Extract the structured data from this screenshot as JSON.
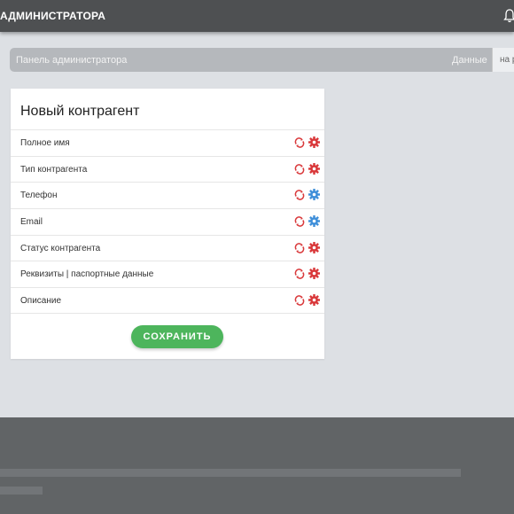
{
  "header": {
    "title": "АДМИНИСТРАТОРА",
    "notification_icon": "bell-icon"
  },
  "breadcrumb": {
    "home": "Панель администратора",
    "current": "Данные",
    "cut_off": "на р"
  },
  "form": {
    "title": "Новый контрагент",
    "fields": [
      {
        "label": "Полное имя",
        "gear_color": "#d9383a"
      },
      {
        "label": "Тип контрагента",
        "gear_color": "#d9383a"
      },
      {
        "label": "Телефон",
        "gear_color": "#3f8fd9"
      },
      {
        "label": "Email",
        "gear_color": "#3f8fd9"
      },
      {
        "label": "Статус контрагента",
        "gear_color": "#d9383a"
      },
      {
        "label": "Реквизиты | паспортные данные",
        "gear_color": "#d9383a"
      },
      {
        "label": "Описание",
        "gear_color": "#d9383a"
      }
    ],
    "sync_color": "#d9383a",
    "save_label": "СОХРАНИТЬ",
    "save_color": "#4db55c"
  }
}
